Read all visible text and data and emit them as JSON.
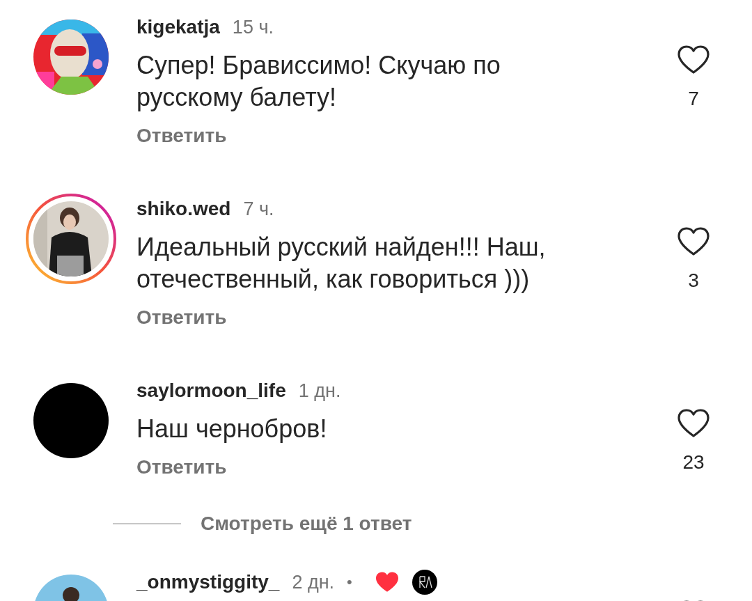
{
  "items": [
    {
      "kind": "comment",
      "username": "kigekatja",
      "time": "15 ч.",
      "text": "Супер! Брависсимо! Скучаю по русскому балету!",
      "reply": "Ответить",
      "likes": "7",
      "liked": false,
      "story_ring": false,
      "liked_by_author": false
    },
    {
      "kind": "comment",
      "username": "shiko.wed",
      "time": "7 ч.",
      "text": "Идеальный русский найден!!! Наш, отечественный, как говориться )))",
      "reply": "Ответить",
      "likes": "3",
      "liked": false,
      "story_ring": true,
      "liked_by_author": false
    },
    {
      "kind": "comment",
      "username": "saylormoon_life",
      "time": "1 дн.",
      "text": "Наш чернобров!",
      "reply": "Ответить",
      "likes": "23",
      "liked": false,
      "story_ring": false,
      "liked_by_author": false
    },
    {
      "kind": "more_replies",
      "label": "Смотреть ещё 1 ответ"
    },
    {
      "kind": "comment",
      "username": "_onmystiggity_",
      "time": "2 дн.",
      "separator": "•",
      "liked": false,
      "story_ring": false,
      "liked_by_author": true
    }
  ]
}
